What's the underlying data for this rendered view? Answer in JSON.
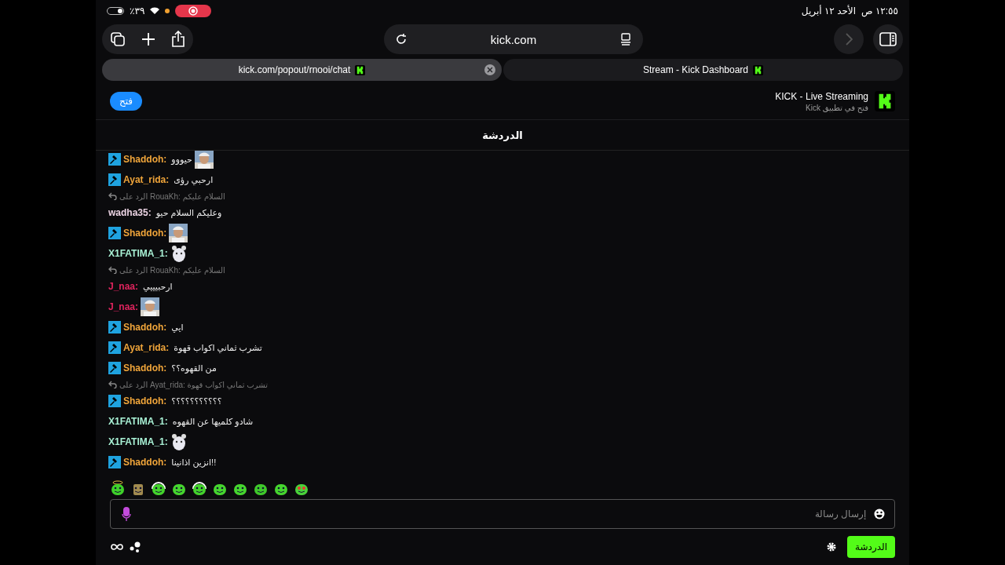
{
  "status_bar": {
    "battery": "٪٣٩",
    "recording": true,
    "date": "الأحد ١٢ أبريل",
    "time": "١٢:٥٥ ص"
  },
  "toolbar": {
    "address": "kick.com",
    "forward_disabled": true
  },
  "tabs": [
    {
      "label": "Stream - Kick Dashboard",
      "selected": false
    },
    {
      "label": "kick.com/popout/rnooi/chat",
      "selected": true
    }
  ],
  "app_banner": {
    "button": "فتح",
    "title": "KICK - Live Streaming",
    "subtitle": "فتح في تطبيق Kick"
  },
  "chat": {
    "title": "الدردشة",
    "messages": [
      {
        "kind": "message",
        "user": "Shaddoh:",
        "color": "#f0a53a",
        "moderator": true,
        "text": "حيووو"
      },
      {
        "kind": "message",
        "user": "Ayat_rida:",
        "color": "#f0a53a",
        "moderator": true,
        "text": "ارحبي رؤى"
      },
      {
        "kind": "reply",
        "text": "الرد على RouaKh: السلام عليكم"
      },
      {
        "kind": "message",
        "user": "wadha35:",
        "color": "#ecd4e4",
        "moderator": false,
        "text": "وعليكم السلام حيو"
      },
      {
        "kind": "message",
        "user": "Shaddoh:",
        "color": "#f0a53a",
        "moderator": true
      },
      {
        "kind": "message",
        "user": "X1FATIMA_1:",
        "color": "#a8f0d4",
        "moderator": false,
        "emote": {
          "kind": "sticker"
        }
      },
      {
        "kind": "reply",
        "text": "الرد على RouaKh: السلام عليكم"
      },
      {
        "kind": "message",
        "user": "J_naa:",
        "color": "#e0245e",
        "moderator": false,
        "text": "ارحبيييي"
      },
      {
        "kind": "message",
        "user": "J_naa:",
        "color": "#e0245e",
        "moderator": false
      },
      {
        "kind": "message",
        "user": "Shaddoh:",
        "color": "#f0a53a",
        "moderator": true,
        "text": "ايي"
      },
      {
        "kind": "message",
        "user": "Ayat_rida:",
        "color": "#f0a53a",
        "moderator": true,
        "text": "تشرب ثماني اكواب قهوة"
      },
      {
        "kind": "message",
        "user": "Shaddoh:",
        "color": "#f0a53a",
        "moderator": true,
        "text": "من القهوه؟؟"
      },
      {
        "kind": "reply",
        "text": "الرد على Ayat_rida: تشرب ثماني اكواب قهوة"
      },
      {
        "kind": "message",
        "user": "Shaddoh:",
        "color": "#f0a53a",
        "moderator": true,
        "text": "؟؟؟؟؟؟؟؟؟؟؟"
      },
      {
        "kind": "message",
        "user": "X1FATIMA_1:",
        "color": "#a8f0d4",
        "moderator": false,
        "text": "شادو كلميها عن القهوه"
      },
      {
        "kind": "message",
        "user": "X1FATIMA_1:",
        "color": "#a8f0d4",
        "moderator": false,
        "emote": {
          "kind": "sticker"
        }
      },
      {
        "kind": "message",
        "user": "Shaddoh:",
        "color": "#f0a53a",
        "moderator": true,
        "text": "انزين اذانينا!!"
      }
    ]
  },
  "emotes": [
    {
      "kind": "halo"
    },
    {
      "kind": "box"
    },
    {
      "kind": "headphones"
    },
    {
      "kind": "smile"
    },
    {
      "kind": "headphones"
    },
    {
      "kind": "smile"
    },
    {
      "kind": "smile"
    },
    {
      "kind": "laugh"
    },
    {
      "kind": "smile"
    },
    {
      "kind": "hearts"
    }
  ],
  "composer": {
    "placeholder": "إرسال رسالة"
  },
  "footer": {
    "chat_button": "الدردشة"
  }
}
